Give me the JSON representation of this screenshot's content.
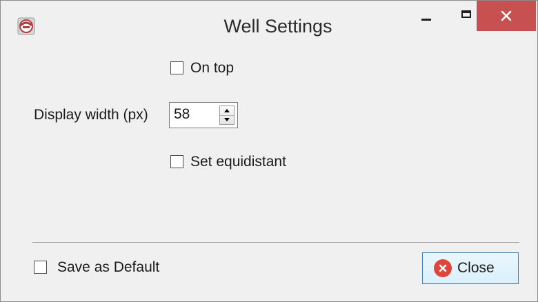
{
  "window": {
    "title": "Well Settings",
    "app_icon": "app-logo-icon",
    "controls": {
      "minimize_icon": "minimize-icon",
      "maximize_icon": "maximize-icon",
      "close_icon": "close-icon",
      "close_color": "#c75050"
    }
  },
  "settings": {
    "on_top": {
      "label": "On top",
      "checked": false
    },
    "display_width": {
      "label": "Display width (px)",
      "value": "58"
    },
    "set_equidistant": {
      "label": "Set equidistant",
      "checked": false
    }
  },
  "footer": {
    "save_default": {
      "label": "Save as Default",
      "checked": false
    },
    "close_button": {
      "label": "Close",
      "icon": "close-circle-icon",
      "icon_color": "#e0443a"
    }
  }
}
